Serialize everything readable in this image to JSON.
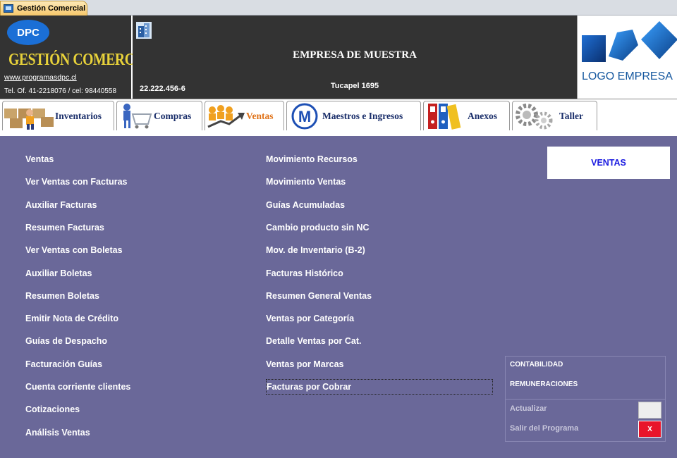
{
  "window": {
    "tab_title": "Gestión Comercial"
  },
  "brand": {
    "logo": "DPC",
    "title": "GESTIÓN COMERCIAL",
    "website": "www.programasdpc.cl",
    "phone": "Tel. Of. 41-2218076 / cel: 98440558"
  },
  "company": {
    "name": "EMPRESA DE MUESTRA",
    "rut": "22.222.456-6",
    "address": "Tucapel 1695",
    "logo_text": "LOGO EMPRESA"
  },
  "tabs": [
    {
      "label": "Inventarios",
      "icon": "warehouse-worker-icon"
    },
    {
      "label": "Compras",
      "icon": "shopping-cart-icon"
    },
    {
      "label": "Ventas",
      "icon": "sales-growth-icon",
      "active": true
    },
    {
      "label": "Maestros e Ingresos",
      "icon": "m-circle-icon"
    },
    {
      "label": "Anexos",
      "icon": "binders-icon"
    },
    {
      "label": "Taller",
      "icon": "gears-icon"
    }
  ],
  "menu_left": [
    "Ventas",
    "Ver Ventas con Facturas",
    "Auxiliar Facturas",
    "Resumen Facturas",
    "Ver Ventas con Boletas",
    "Auxiliar Boletas",
    "Resumen Boletas",
    "Emitir Nota de Crédito",
    "Guías de Despacho",
    "Facturación Guías",
    "Cuenta corriente clientes",
    "Cotizaciones",
    "Análisis Ventas"
  ],
  "menu_right": [
    "Movimiento Recursos",
    "Movimiento Ventas",
    "Guías Acumuladas",
    "Cambio producto sin NC",
    "Mov. de Inventario (B-2)",
    "Facturas Histórico",
    "Resumen General Ventas",
    "Ventas por Categoría",
    "Detalle Ventas por Cat.",
    "Ventas por Marcas",
    "Facturas  por Cobrar"
  ],
  "section_title": "VENTAS",
  "side_panel": {
    "contabilidad": "CONTABILIDAD",
    "remuneraciones": "REMUNERACIONES",
    "actualizar": "Actualizar",
    "salir": "Salir del Programa",
    "exit_button": "X"
  },
  "colors": {
    "main_bg": "#6a6899",
    "header_bg": "#333333",
    "brand_title": "#e8d23a",
    "active_tab": "#e0741b",
    "section_text": "#1a1ae0",
    "exit_button": "#e8142a"
  }
}
